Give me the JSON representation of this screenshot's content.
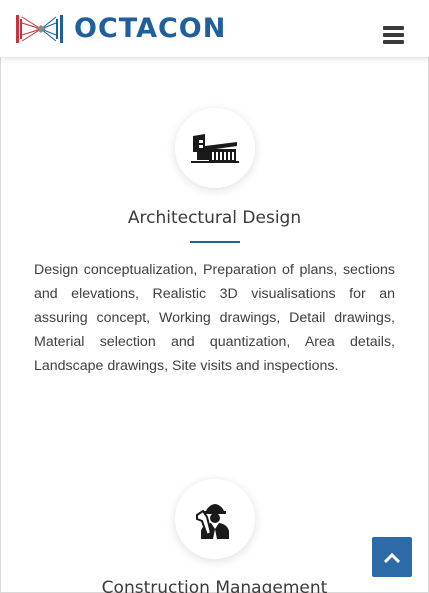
{
  "header": {
    "brand": "OCTACON",
    "logo_icon": "octacon-logo-mark",
    "menu_icon": "hamburger-menu-icon"
  },
  "services": [
    {
      "icon": "building-icon",
      "title": "Architectural Design",
      "description": "Design conceptualization, Preparation of plans, sections and elevations, Realistic 3D visualisations for an assuring concept, Working drawings, Detail drawings, Material selection and quantization, Area details, Landscape drawings, Site visits and inspections."
    },
    {
      "icon": "engineer-icon",
      "title": "Construction Management"
    }
  ],
  "back_to_top": {
    "icon": "chevron-up-icon"
  },
  "colors": {
    "brand_blue": "#1f5f9e",
    "logo_red": "#c8323c",
    "button_blue": "#2d6ba8"
  }
}
